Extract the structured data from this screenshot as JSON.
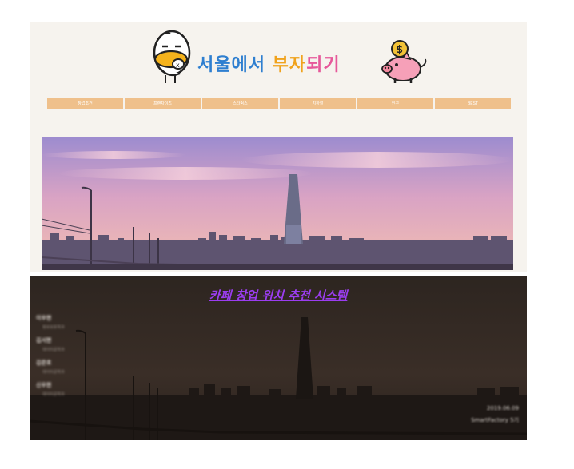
{
  "slide1": {
    "logo": {
      "part1": "서울에서",
      "part2": "부자",
      "part3": "되기",
      "mascot_icon": "duck-mascot-icon",
      "pig_icon": "piggy-bank-icon",
      "colors": {
        "blue": "#2f7fd0",
        "orange": "#f0a21c",
        "pink": "#e6589a"
      }
    },
    "nav": [
      {
        "label": "창업조건"
      },
      {
        "label": "프랜차이즈"
      },
      {
        "label": "스타벅스"
      },
      {
        "label": "지하철"
      },
      {
        "label": "인구"
      },
      {
        "label": "BEST"
      }
    ],
    "nav_color": "#efc08b"
  },
  "slide2": {
    "title": "카페 창업 위치 추천 시스템",
    "title_color": "#9b3df0",
    "members": [
      {
        "name": "이우현",
        "dept": "정보보호학과"
      },
      {
        "name": "김서현",
        "dept": "데이터공학과"
      },
      {
        "name": "김준호",
        "dept": "데이터공학과"
      },
      {
        "name": "신우현",
        "dept": "데이터공학과"
      }
    ],
    "date": "2019.06.09",
    "team": "SmartFactory 5기"
  }
}
